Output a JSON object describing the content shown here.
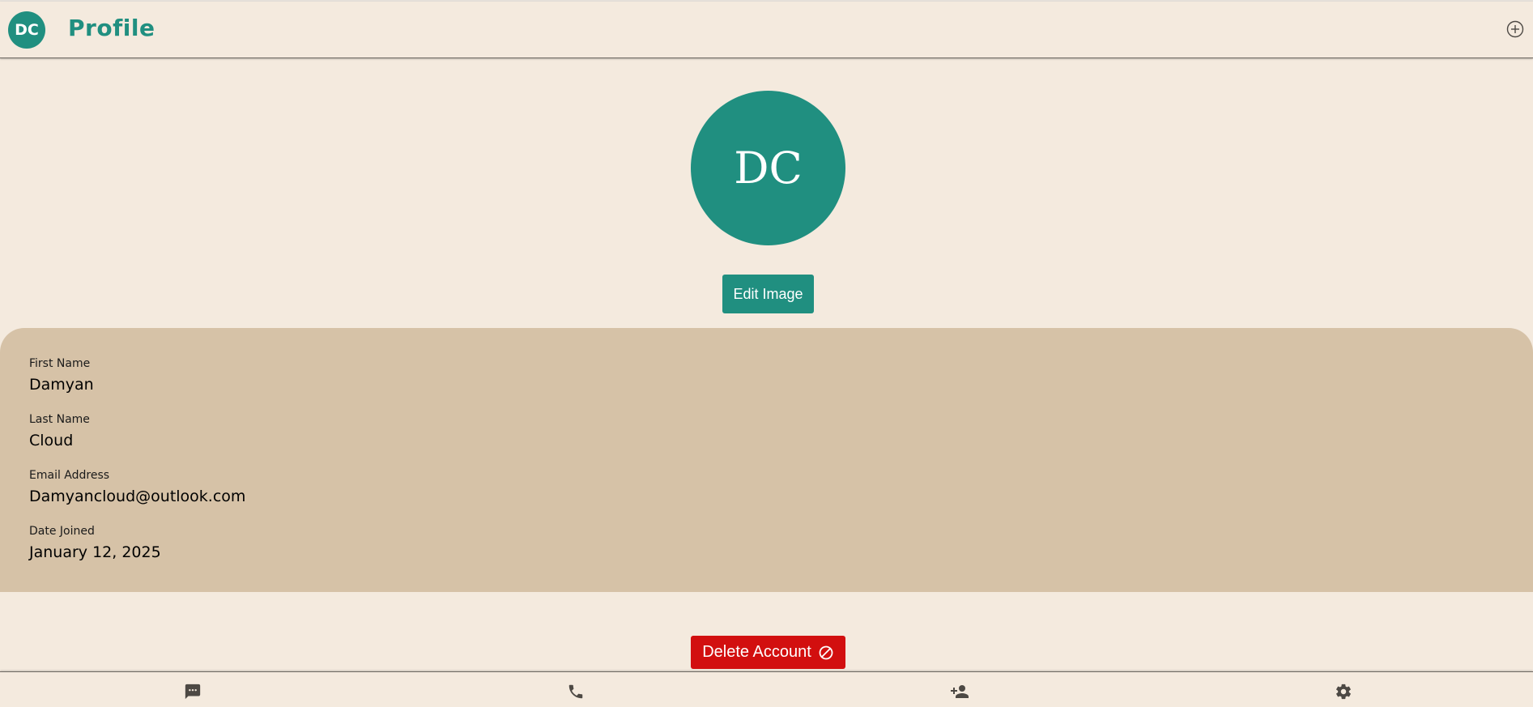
{
  "header": {
    "avatar_initials": "DC",
    "title": "Profile",
    "add_icon": "plus-circle-icon"
  },
  "profile": {
    "avatar_initials": "DC",
    "edit_image_label": "Edit Image"
  },
  "fields": [
    {
      "label": "First Name",
      "value": "Damyan"
    },
    {
      "label": "Last Name",
      "value": "Cloud"
    },
    {
      "label": "Email Address",
      "value": "Damyancloud@outlook.com"
    },
    {
      "label": "Date Joined",
      "value": "January 12, 2025"
    }
  ],
  "delete_account": {
    "label": "Delete Account",
    "icon": "block-icon"
  },
  "bottom_nav": [
    {
      "name": "messages",
      "icon": "chat-icon"
    },
    {
      "name": "calls",
      "icon": "phone-icon"
    },
    {
      "name": "contacts",
      "icon": "add-person-icon"
    },
    {
      "name": "settings",
      "icon": "gear-icon"
    }
  ],
  "colors": {
    "background": "#f4eade",
    "accent": "#208f80",
    "panel": "#d6c2a7",
    "danger": "#d20f0f",
    "nav_icon": "#4d4944"
  }
}
